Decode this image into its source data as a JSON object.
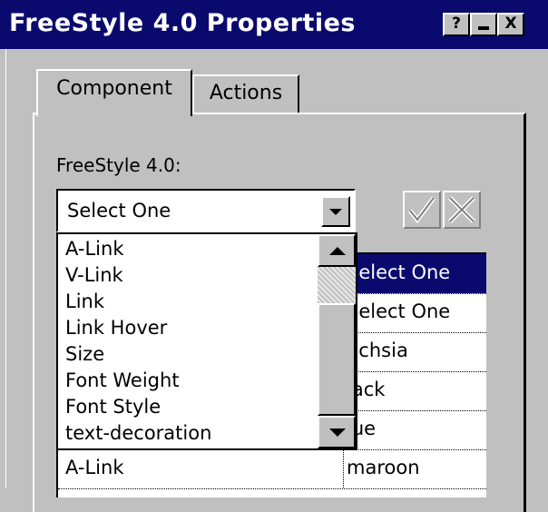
{
  "window": {
    "title": "FreeStyle 4.0 Properties",
    "buttons": {
      "help": "?",
      "minimize": "_",
      "close": "X"
    }
  },
  "tabs": [
    {
      "label": "Component",
      "active": true
    },
    {
      "label": "Actions",
      "active": false
    }
  ],
  "component": {
    "label": "FreeStyle 4.0:",
    "combo_value": "Select One",
    "apply_icon": "check-icon",
    "cancel_icon": "x-icon"
  },
  "dropdown": {
    "items": [
      "A-Link",
      "V-Link",
      "Link",
      "Link Hover",
      "Size",
      "Font Weight",
      "Font Style",
      "text-decoration"
    ]
  },
  "grid": {
    "rows": [
      {
        "name": "",
        "value": "Select One",
        "selected": true
      },
      {
        "name": "",
        "value": "Select One"
      },
      {
        "name": "",
        "value": "uchsia"
      },
      {
        "name": "",
        "value": "lack"
      },
      {
        "name": "",
        "value": "lue"
      },
      {
        "name": "A-Link",
        "value": "maroon"
      }
    ]
  },
  "colors": {
    "titlebar": "#0a0a6e",
    "face": "#c0c0c0",
    "selection": "#0a0a6e"
  }
}
